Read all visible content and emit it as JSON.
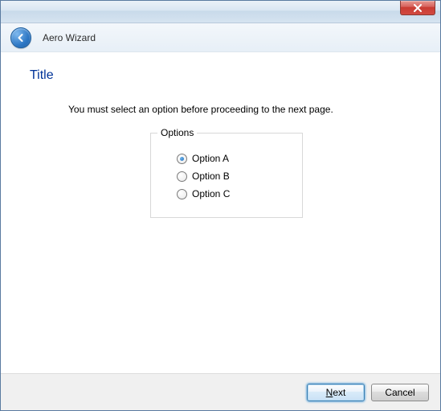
{
  "window": {
    "wizard_name": "Aero Wizard"
  },
  "page": {
    "title": "Title",
    "instruction": "You must select an option before proceeding to the next page."
  },
  "options": {
    "legend": "Options",
    "items": [
      {
        "label": "Option A",
        "selected": true
      },
      {
        "label": "Option B",
        "selected": false
      },
      {
        "label": "Option C",
        "selected": false
      }
    ]
  },
  "footer": {
    "next_label": "Next",
    "cancel_label": "Cancel"
  }
}
